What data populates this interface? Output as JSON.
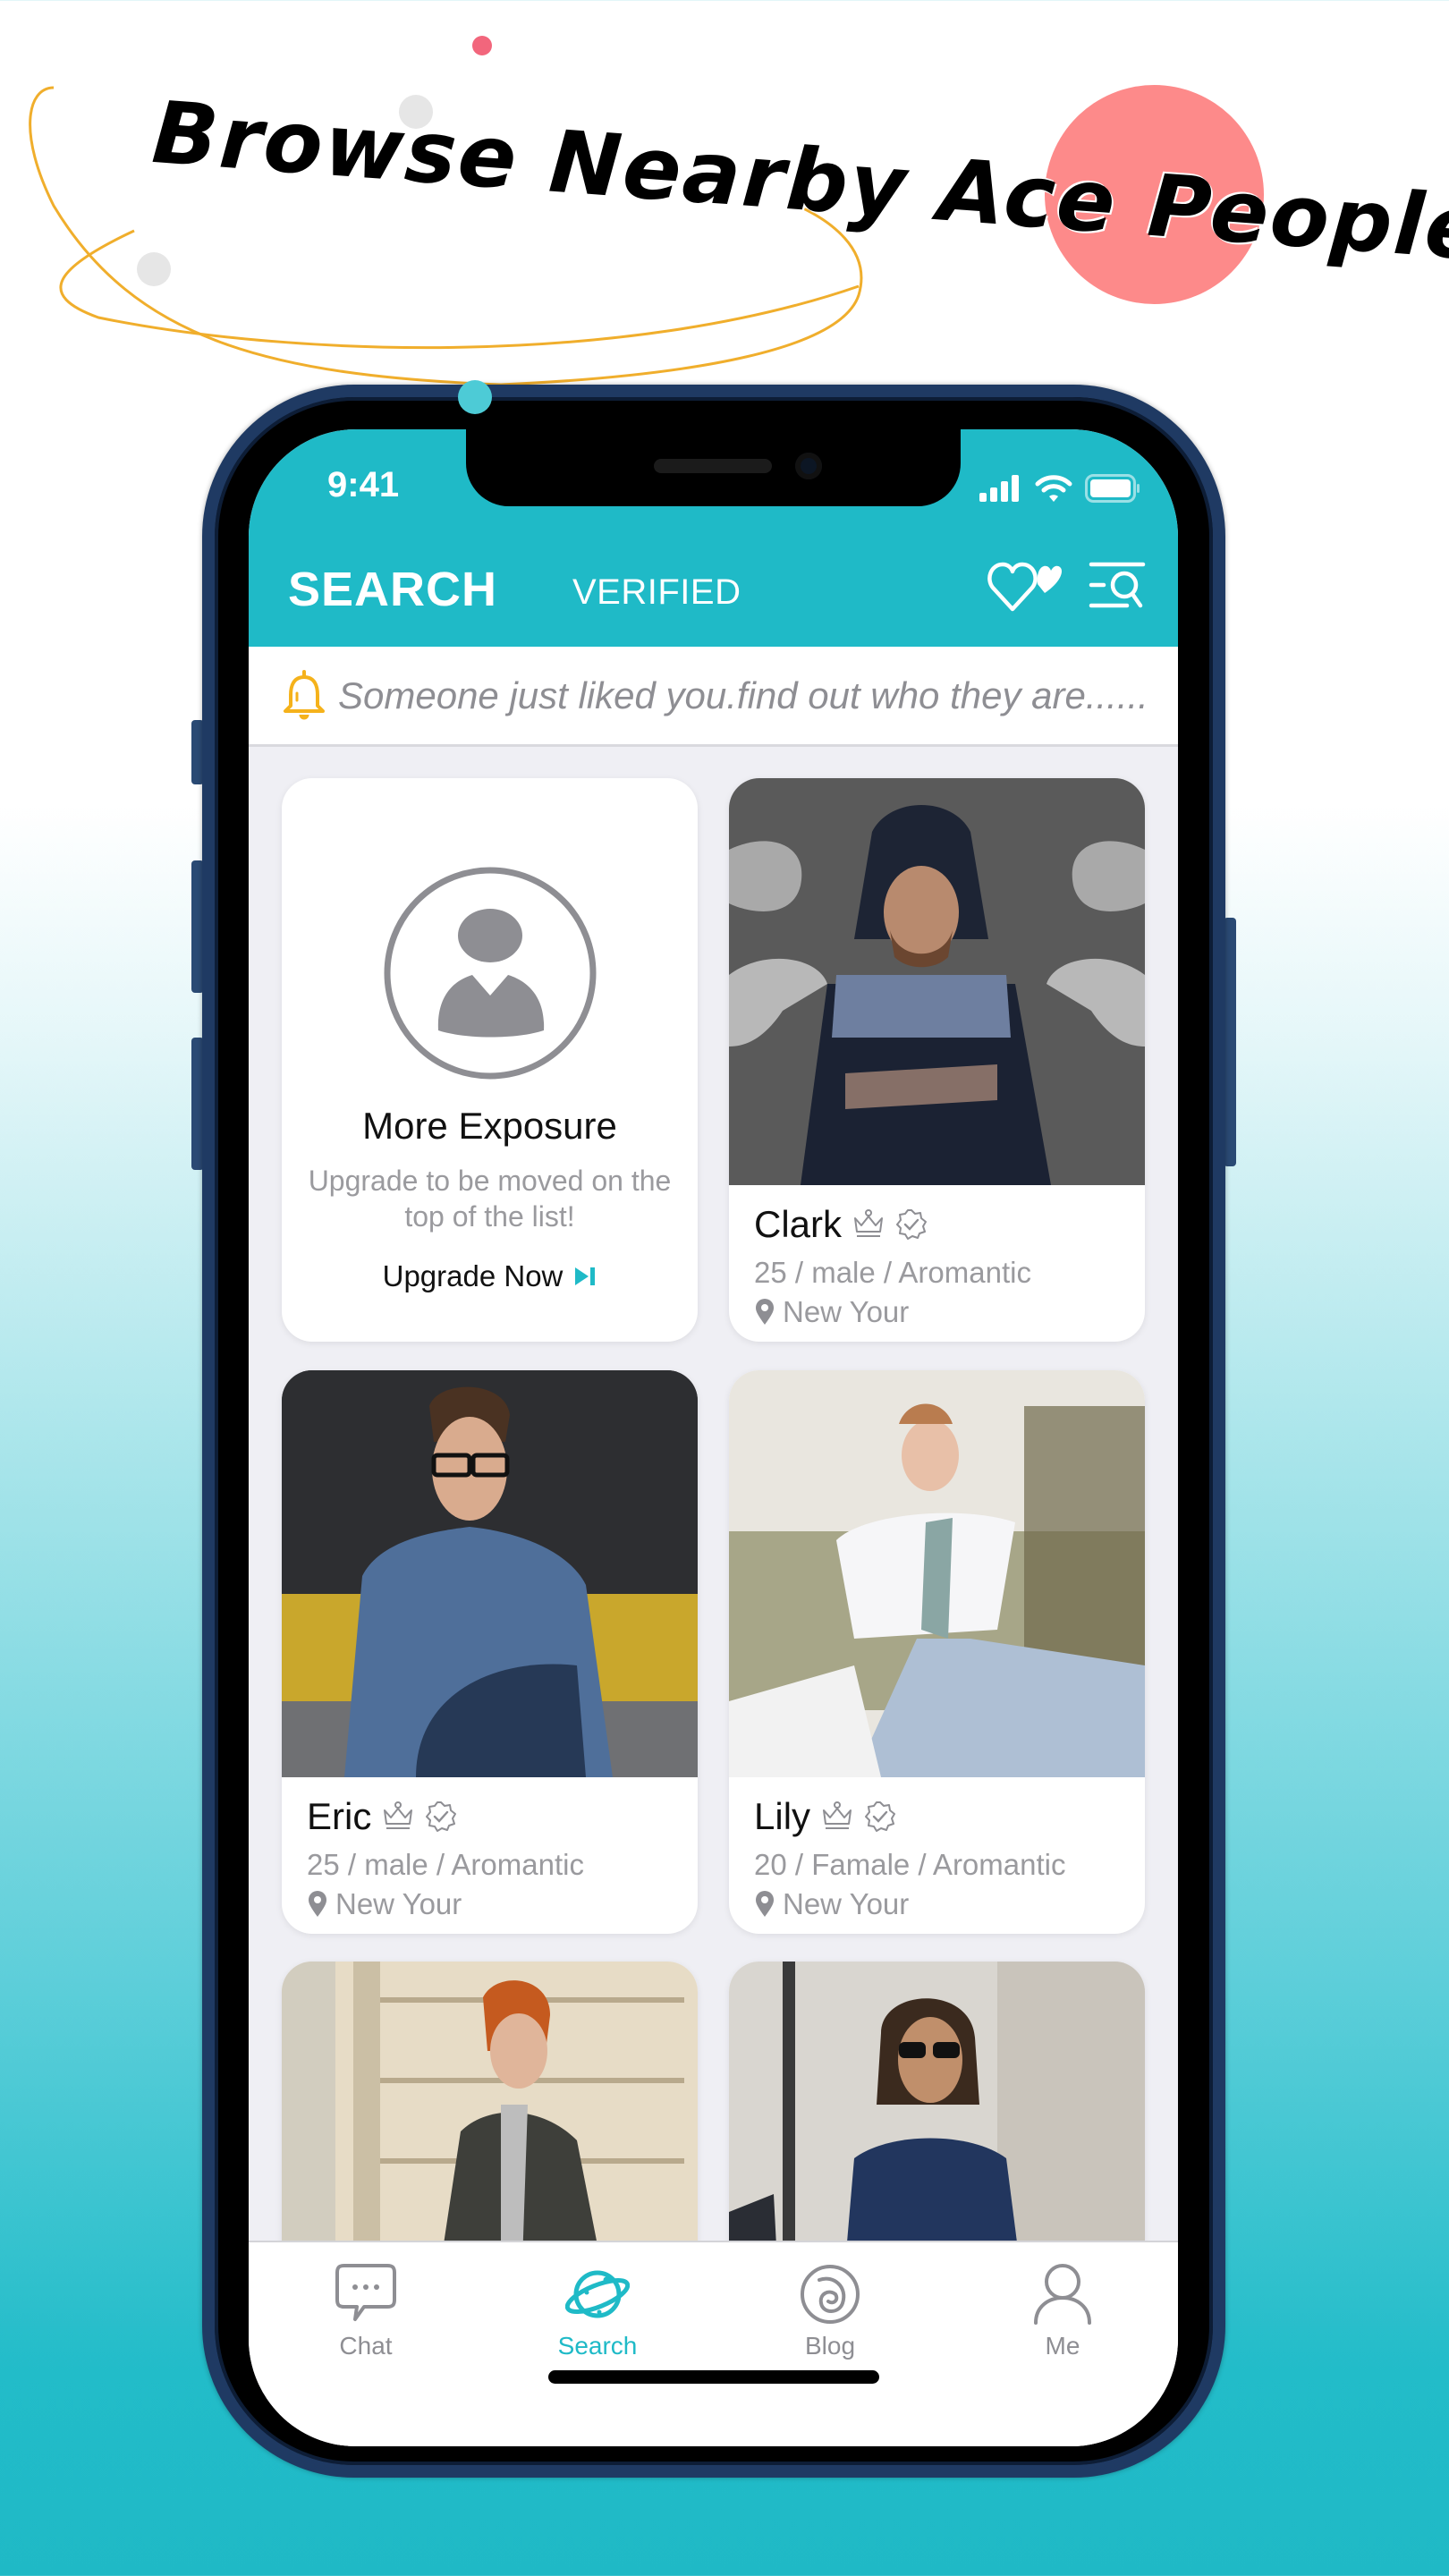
{
  "promo_headline": "Browse Nearby Ace People",
  "status_bar": {
    "time": "9:41",
    "icons": [
      "signal-icon",
      "wifi-icon",
      "battery-icon"
    ]
  },
  "header": {
    "active_tab": "SEARCH",
    "secondary_tab": "VERIFIED",
    "actions": [
      "likes-hearts-icon",
      "filter-search-icon"
    ]
  },
  "notification": {
    "icon": "bell-icon",
    "text": "Someone just liked you.find out who they are......"
  },
  "promo_card": {
    "title": "More Exposure",
    "subtitle": "Upgrade to be moved on the top of the list!",
    "cta_label": "Upgrade Now",
    "cta_icon": "skip-forward-icon"
  },
  "profiles": [
    {
      "name": "Clark",
      "meta": "25 / male / Aromantic",
      "location": "New Your",
      "vip": true,
      "verified": true
    },
    {
      "name": "Eric",
      "meta": "25 / male / Aromantic",
      "location": "New Your",
      "vip": true,
      "verified": true
    },
    {
      "name": "Lily",
      "meta": "20 / Famale / Aromantic",
      "location": "New Your",
      "vip": true,
      "verified": true
    },
    {
      "name": "",
      "meta": "",
      "location": ""
    },
    {
      "name": "",
      "meta": "",
      "location": ""
    }
  ],
  "tabbar": {
    "items": [
      {
        "label": "Chat",
        "icon": "chat-bubble-icon",
        "active": false
      },
      {
        "label": "Search",
        "icon": "planet-icon",
        "active": true
      },
      {
        "label": "Blog",
        "icon": "blog-spiral-icon",
        "active": false
      },
      {
        "label": "Me",
        "icon": "person-icon",
        "active": false
      }
    ]
  },
  "colors": {
    "brand_teal": "#1fbac7",
    "notification_bell": "#f5b21b",
    "accent_coral": "#fd8a8a",
    "text_secondary": "#8e8e93",
    "list_background": "#efeff4"
  }
}
